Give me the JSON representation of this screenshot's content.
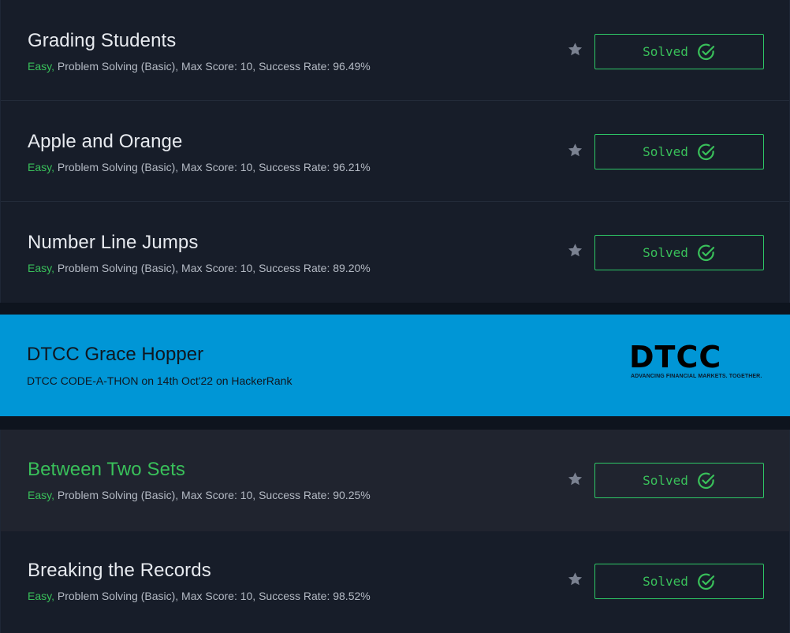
{
  "challenges": [
    {
      "title": "Grading Students",
      "difficulty": "Easy,",
      "details": " Problem Solving (Basic), Max Score: 10, Success Rate: 96.49%",
      "status_label": "Solved"
    },
    {
      "title": "Apple and Orange",
      "difficulty": "Easy,",
      "details": " Problem Solving (Basic), Max Score: 10, Success Rate: 96.21%",
      "status_label": "Solved"
    },
    {
      "title": "Number Line Jumps",
      "difficulty": "Easy,",
      "details": " Problem Solving (Basic), Max Score: 10, Success Rate: 89.20%",
      "status_label": "Solved"
    },
    {
      "title": "Between Two Sets",
      "difficulty": "Easy,",
      "details": " Problem Solving (Basic), Max Score: 10, Success Rate: 90.25%",
      "status_label": "Solved"
    },
    {
      "title": "Breaking the Records",
      "difficulty": "Easy,",
      "details": " Problem Solving (Basic), Max Score: 10, Success Rate: 98.52%",
      "status_label": "Solved"
    }
  ],
  "banner": {
    "title": "DTCC Grace Hopper",
    "subtitle": "DTCC CODE-A-THON on 14th Oct'22 on HackerRank",
    "logo_text": "DTCC",
    "logo_tagline": "ADVANCING FINANCIAL MARKETS. TOGETHER.",
    "background_color": "#0096d6"
  },
  "icons": {
    "star": "star-icon",
    "check": "check-circle-icon"
  },
  "colors": {
    "background": "#0e141e",
    "card": "#171d29",
    "card_hover": "#20242f",
    "accent_green": "#39c05a",
    "title_text": "#e7eaef",
    "meta_text": "#b4bac4"
  }
}
